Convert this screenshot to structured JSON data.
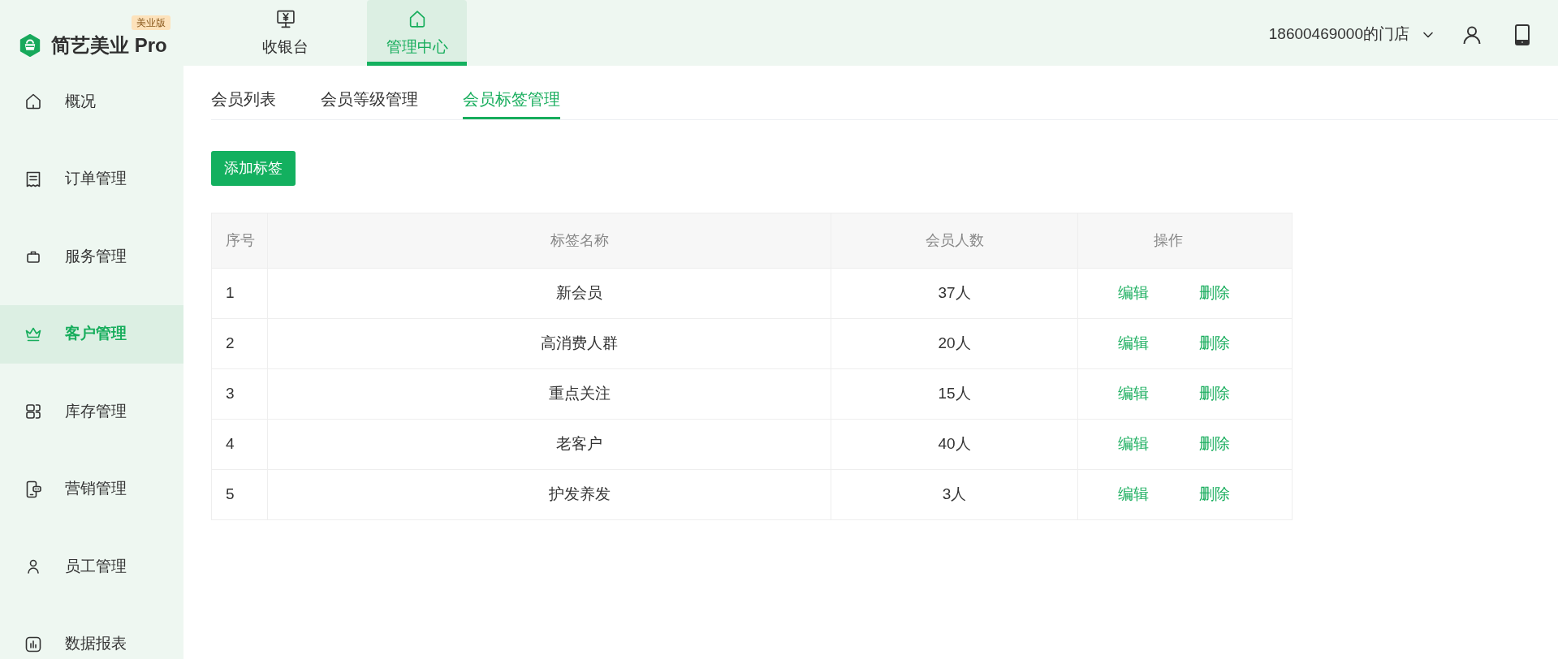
{
  "brand": {
    "name": "简艺美业 Pro",
    "badge": "美业版"
  },
  "top_nav": [
    {
      "label": "收银台",
      "selected": false
    },
    {
      "label": "管理中心",
      "selected": true
    }
  ],
  "store_menu": {
    "label": "18600469000的门店"
  },
  "sidebar": {
    "items": [
      {
        "label": "概况",
        "selected": false
      },
      {
        "label": "订单管理",
        "selected": false
      },
      {
        "label": "服务管理",
        "selected": false
      },
      {
        "label": "客户管理",
        "selected": true
      },
      {
        "label": "库存管理",
        "selected": false
      },
      {
        "label": "营销管理",
        "selected": false
      },
      {
        "label": "员工管理",
        "selected": false
      },
      {
        "label": "数据报表",
        "selected": false
      }
    ]
  },
  "tabs": [
    {
      "label": "会员列表",
      "selected": false
    },
    {
      "label": "会员等级管理",
      "selected": false
    },
    {
      "label": "会员标签管理",
      "selected": true
    }
  ],
  "add_button": {
    "label": "添加标签"
  },
  "table": {
    "columns": [
      "序号",
      "标签名称",
      "会员人数",
      "操作"
    ],
    "rows": [
      {
        "cells": [
          "1",
          "新会员",
          "37人"
        ],
        "actions": [
          "编辑",
          "删除"
        ]
      },
      {
        "cells": [
          "2",
          "高消费人群",
          "20人"
        ],
        "actions": [
          "编辑",
          "删除"
        ]
      },
      {
        "cells": [
          "3",
          "重点关注",
          "15人"
        ],
        "actions": [
          "编辑",
          "删除"
        ]
      },
      {
        "cells": [
          "4",
          "老客户",
          "40人"
        ],
        "actions": [
          "编辑",
          "删除"
        ]
      },
      {
        "cells": [
          "5",
          "护发养发",
          "3人"
        ],
        "actions": [
          "编辑",
          "删除"
        ]
      }
    ]
  }
}
